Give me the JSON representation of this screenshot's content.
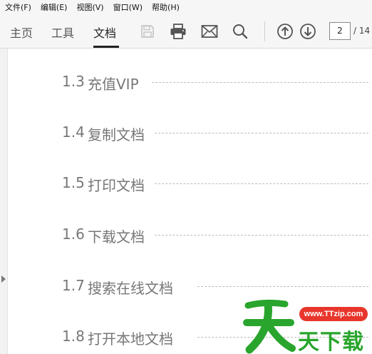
{
  "menu": [
    "文件(F)",
    "编辑(E)",
    "视图(V)",
    "窗口(W)",
    "帮助(H)"
  ],
  "tabs": [
    "主页",
    "工具",
    "文档"
  ],
  "toolbar": {
    "page_current": "2",
    "page_total": "/ 14",
    "icons": [
      "save-icon",
      "print-icon",
      "mail-icon",
      "search-icon",
      "arrow-up-icon",
      "arrow-down-icon"
    ]
  },
  "toc": [
    {
      "num": "1.3",
      "title": "充值VIP"
    },
    {
      "num": "1.4",
      "title": "复制文档"
    },
    {
      "num": "1.5",
      "title": "打印文档"
    },
    {
      "num": "1.6",
      "title": "下载文档"
    },
    {
      "num": "1.7",
      "title": "搜索在线文档"
    },
    {
      "num": "1.8",
      "title": "打开本地文档"
    }
  ],
  "watermark": {
    "url": "www.TTzip.com",
    "name": "天下载"
  },
  "colors": {
    "accent_red": "#e8362c",
    "watermark_green": "#29a52d",
    "text_gray": "#777777"
  }
}
